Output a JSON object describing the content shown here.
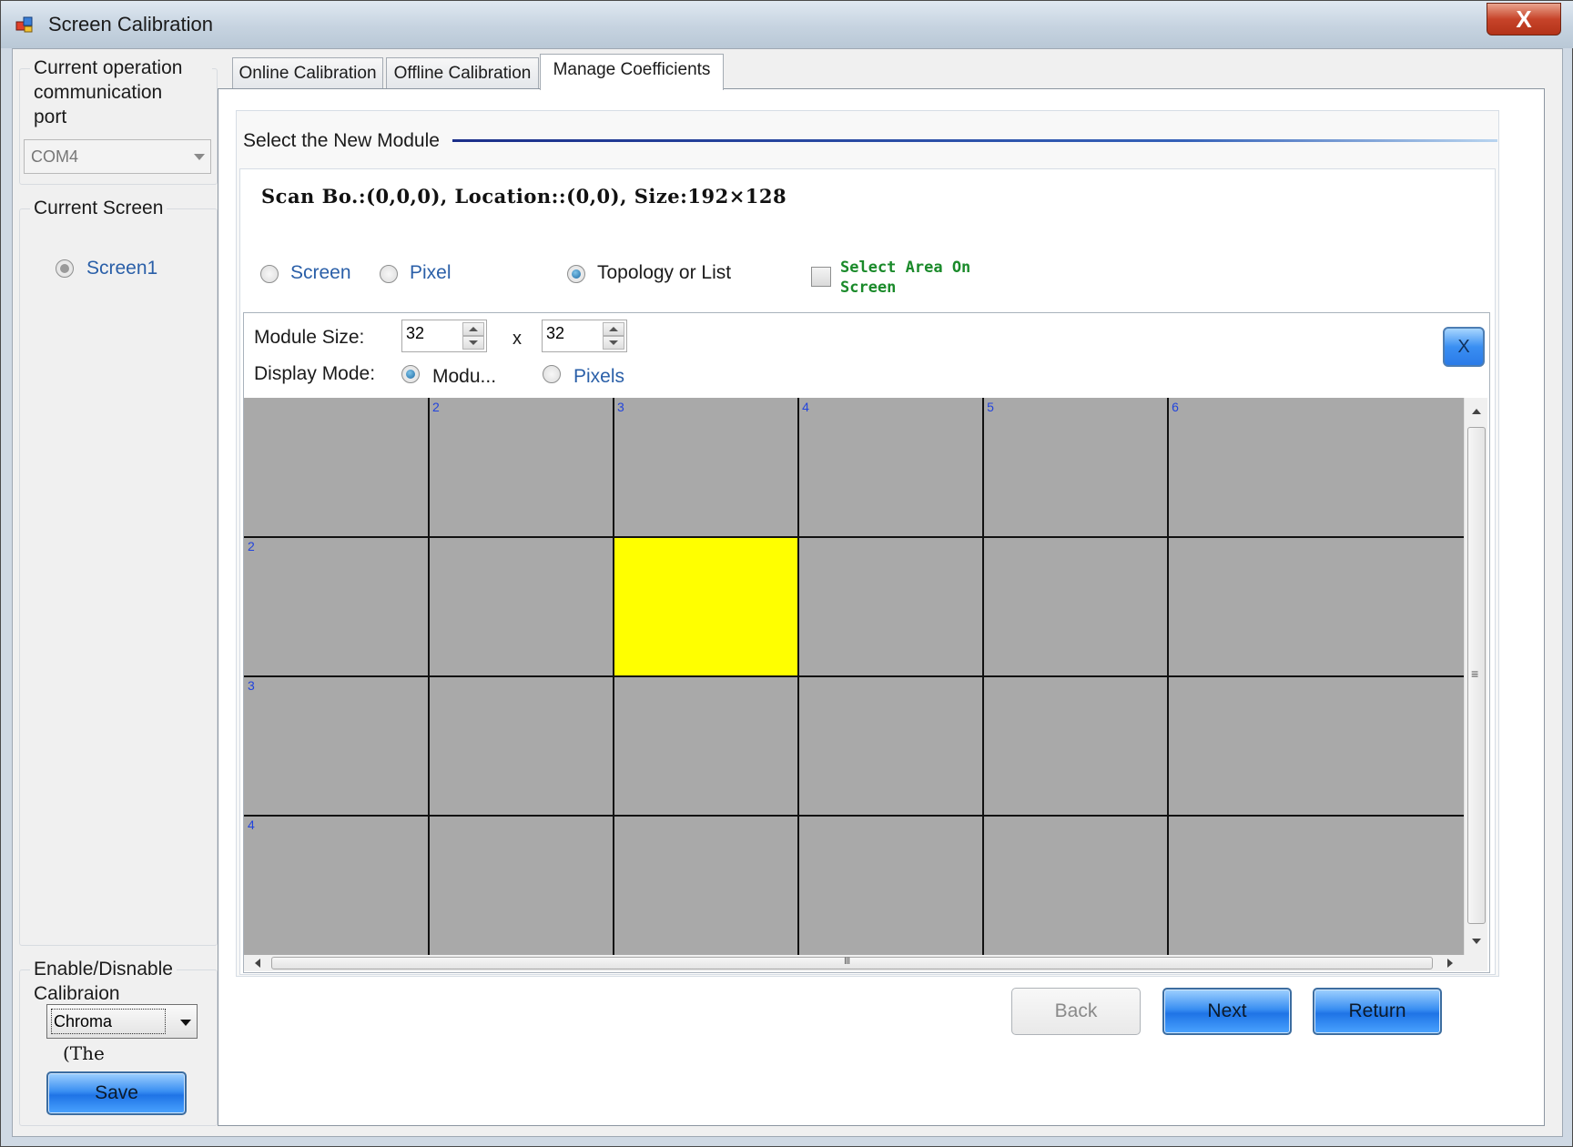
{
  "window": {
    "title": "Screen Calibration",
    "close_label": "X"
  },
  "left_panel": {
    "port_group_label": "Current operation communication port",
    "port_label_lines": [
      "Current operation",
      "communication",
      "port"
    ],
    "port_value": "COM4",
    "screen_group_label": "Current Screen",
    "screens": [
      {
        "label": "Screen1",
        "selected": true
      }
    ],
    "calib_group_label_lines": [
      "Enable/Disnable",
      "Calibraion"
    ],
    "calib_value": "Chroma",
    "calib_note": "(The",
    "save_label": "Save"
  },
  "tabs": [
    {
      "label": "Online Calibration",
      "active": false
    },
    {
      "label": "Offline Calibration",
      "active": false
    },
    {
      "label": "Manage Coefficients",
      "active": true
    }
  ],
  "main": {
    "section_title": "Select the New Module",
    "info_line": "Scan Bo.:(0,0,0), Location::(0,0),  Size:192×128",
    "options": [
      {
        "label": "Screen",
        "checked": false
      },
      {
        "label": "Pixel",
        "checked": false
      },
      {
        "label": "Topology or List",
        "checked": true
      }
    ],
    "select_area_lines": [
      "Select Area On",
      "Screen"
    ],
    "select_area_checked": false,
    "module_size_label": "Module Size:",
    "module_width": "32",
    "module_height": "32",
    "times_label": "x",
    "display_mode_label": "Display Mode:",
    "display_modes": [
      {
        "label": "Modu...",
        "checked": true
      },
      {
        "label": "Pixels",
        "checked": false
      }
    ],
    "close_x_label": "X",
    "grid": {
      "columns": 6,
      "rows": 4,
      "column_numbers": [
        "2",
        "3",
        "4",
        "5",
        "6"
      ],
      "row_numbers": [
        "2",
        "3",
        "4"
      ],
      "selected_cell": {
        "row": 2,
        "col": 3
      },
      "cell_color": "#a9a9a9",
      "selected_color": "#ffff00"
    },
    "scroll_grip_label": "III",
    "vscroll_grip_label": "≡",
    "back_label": "Back",
    "next_label": "Next",
    "return_label": "Return"
  }
}
